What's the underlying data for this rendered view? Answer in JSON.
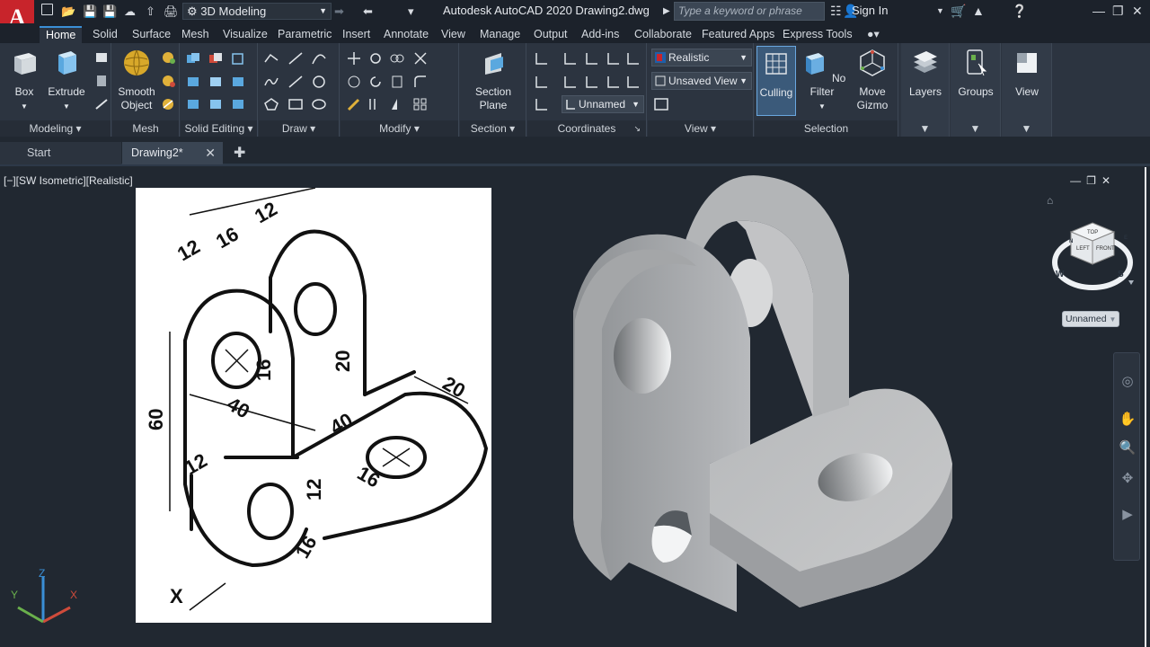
{
  "titlebar": {
    "app_logo": "A",
    "workspace": "3D Modeling",
    "app_title": "Autodesk AutoCAD 2020   Drawing2.dwg",
    "search_placeholder": "Type a keyword or phrase",
    "sign_in": "Sign In"
  },
  "ribbon_tabs": [
    "Home",
    "Solid",
    "Surface",
    "Mesh",
    "Visualize",
    "Parametric",
    "Insert",
    "Annotate",
    "View",
    "Manage",
    "Output",
    "Add-ins",
    "Collaborate",
    "Featured Apps",
    "Express Tools"
  ],
  "panels": {
    "modeling": {
      "title": "Modeling ▾",
      "box": "Box",
      "extrude": "Extrude"
    },
    "mesh": {
      "title": "Mesh",
      "smooth_line1": "Smooth",
      "smooth_line2": "Object"
    },
    "solid_editing": {
      "title": "Solid Editing ▾"
    },
    "draw": {
      "title": "Draw ▾"
    },
    "modify": {
      "title": "Modify ▾"
    },
    "section": {
      "title": "Section ▾",
      "plane_line1": "Section",
      "plane_line2": "Plane"
    },
    "coordinates": {
      "title": "Coordinates"
    },
    "view": {
      "title": "View ▾",
      "visual_style": "Realistic",
      "view_name": "Unsaved View"
    },
    "coordinates_ucs": "Unnamed",
    "selection": {
      "title": "Selection",
      "culling": "Culling",
      "no_filter": "No Filter",
      "move_gizmo_line1": "Move",
      "move_gizmo_line2": "Gizmo"
    },
    "layers": "Layers",
    "groups": "Groups",
    "view_btn": "View"
  },
  "file_tabs": {
    "start": "Start",
    "drawing": "Drawing2*"
  },
  "viewport": {
    "label": "[−][SW Isometric][Realistic]",
    "viewcube": {
      "top": "TOP",
      "left": "LEFT",
      "front": "FRONT",
      "w": "W",
      "s": "S",
      "n": "N",
      "e": "E"
    },
    "ucs_name": "Unnamed",
    "ucs_axes": {
      "x": "X",
      "y": "Y",
      "z": "Z"
    }
  },
  "reference_drawing": {
    "dimensions": [
      "12",
      "16",
      "12",
      "60",
      "40",
      "16",
      "20",
      "40",
      "20",
      "12",
      "12",
      "16",
      "16"
    ],
    "axis_label": "X"
  },
  "colors": {
    "accent": "#3a8fd6",
    "logo": "#c8242b",
    "model": "#b9bbbd"
  }
}
